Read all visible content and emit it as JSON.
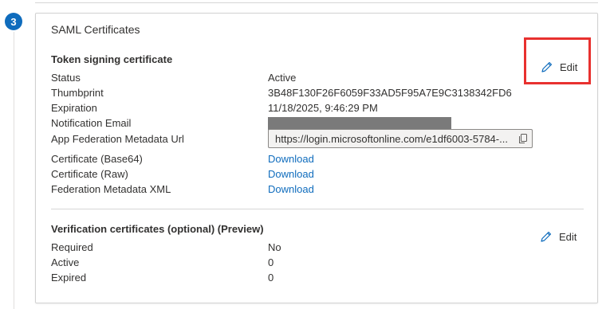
{
  "step": {
    "number": "3"
  },
  "card": {
    "title": "SAML Certificates"
  },
  "token_signing": {
    "title": "Token signing certificate",
    "edit_label": "Edit",
    "rows": [
      {
        "label": "Status",
        "value": "Active"
      },
      {
        "label": "Thumbprint",
        "value": "3B48F130F26F6059F33AD5F95A7E9C3138342FD6"
      },
      {
        "label": "Expiration",
        "value": "11/18/2025, 9:46:29 PM"
      },
      {
        "label": "Notification Email",
        "value": ""
      },
      {
        "label": "App Federation Metadata Url",
        "value": "https://login.microsoftonline.com/e1df6003-5784-..."
      },
      {
        "label": "Certificate (Base64)",
        "value": "Download"
      },
      {
        "label": "Certificate (Raw)",
        "value": "Download"
      },
      {
        "label": "Federation Metadata XML",
        "value": "Download"
      }
    ]
  },
  "verification": {
    "title": "Verification certificates (optional) (Preview)",
    "edit_label": "Edit",
    "rows": [
      {
        "label": "Required",
        "value": "No"
      },
      {
        "label": "Active",
        "value": "0"
      },
      {
        "label": "Expired",
        "value": "0"
      }
    ]
  },
  "colors": {
    "accent": "#0f6cbd",
    "highlight": "#e8312f",
    "redaction": "#7a7a7a"
  },
  "icons": {
    "edit": "pencil-icon",
    "copy": "copy-icon"
  }
}
